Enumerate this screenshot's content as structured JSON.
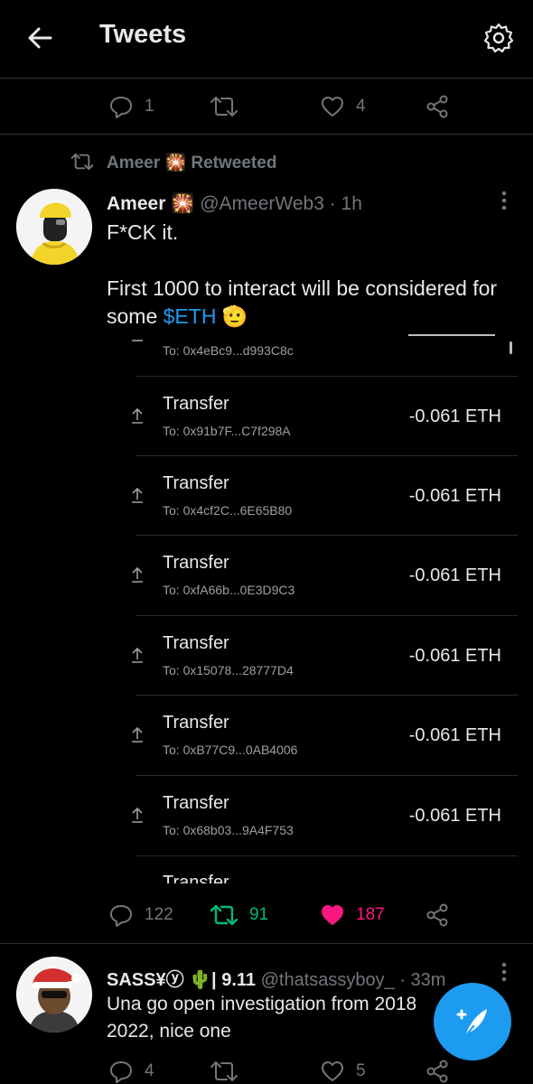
{
  "header": {
    "title": "Tweets"
  },
  "prev_tweet": {
    "reply_count": "1",
    "retweet_count": "",
    "like_count": "4"
  },
  "retweet_banner": {
    "user": "Ameer",
    "emoji": "🎇",
    "label": "Retweeted"
  },
  "tweet": {
    "name": "Ameer",
    "emoji": "🎇",
    "handle": "@AmeerWeb3",
    "time": "· 1h",
    "line1": "F*CK it.",
    "line2": "First 1000 to interact will be considered for",
    "line3_prefix": "some ",
    "line3_link": "$ETH",
    "line3_suffix": " 🫡",
    "reply_count": "122",
    "retweet_count": "91",
    "like_count": "187"
  },
  "transfers": {
    "partial_top_to": "To: 0x4eBc9...d993C8c",
    "items": [
      {
        "title": "Transfer",
        "to": "To: 0x91b7F...C7f298A",
        "amount": "-0.061 ETH"
      },
      {
        "title": "Transfer",
        "to": "To: 0x4cf2C...6E65B80",
        "amount": "-0.061 ETH"
      },
      {
        "title": "Transfer",
        "to": "To: 0xfA66b...0E3D9C3",
        "amount": "-0.061 ETH"
      },
      {
        "title": "Transfer",
        "to": "To: 0x15078...28777D4",
        "amount": "-0.061 ETH"
      },
      {
        "title": "Transfer",
        "to": "To: 0xB77C9...0AB4006",
        "amount": "-0.061 ETH"
      },
      {
        "title": "Transfer",
        "to": "To: 0x68b03...9A4F753",
        "amount": "-0.061 ETH"
      }
    ],
    "partial_bottom_title": "Transfer"
  },
  "next_tweet": {
    "name": "SASS¥ⓨ 🌵| 9.11",
    "handle": "@thatsassyboy_",
    "time": "· 33m",
    "line1": "Una go open investigation from 2018",
    "line2": "2022, nice one",
    "reply_count": "4",
    "like_count": "5"
  },
  "colors": {
    "accent": "#1d9bf0",
    "retweet": "#00ba7c",
    "like": "#f91880",
    "muted": "#71767b"
  },
  "icons": [
    "back-arrow-icon",
    "gear-icon",
    "reply-icon",
    "retweet-icon",
    "like-icon",
    "share-icon",
    "more-icon",
    "compose-icon",
    "upload-arrow-icon"
  ]
}
